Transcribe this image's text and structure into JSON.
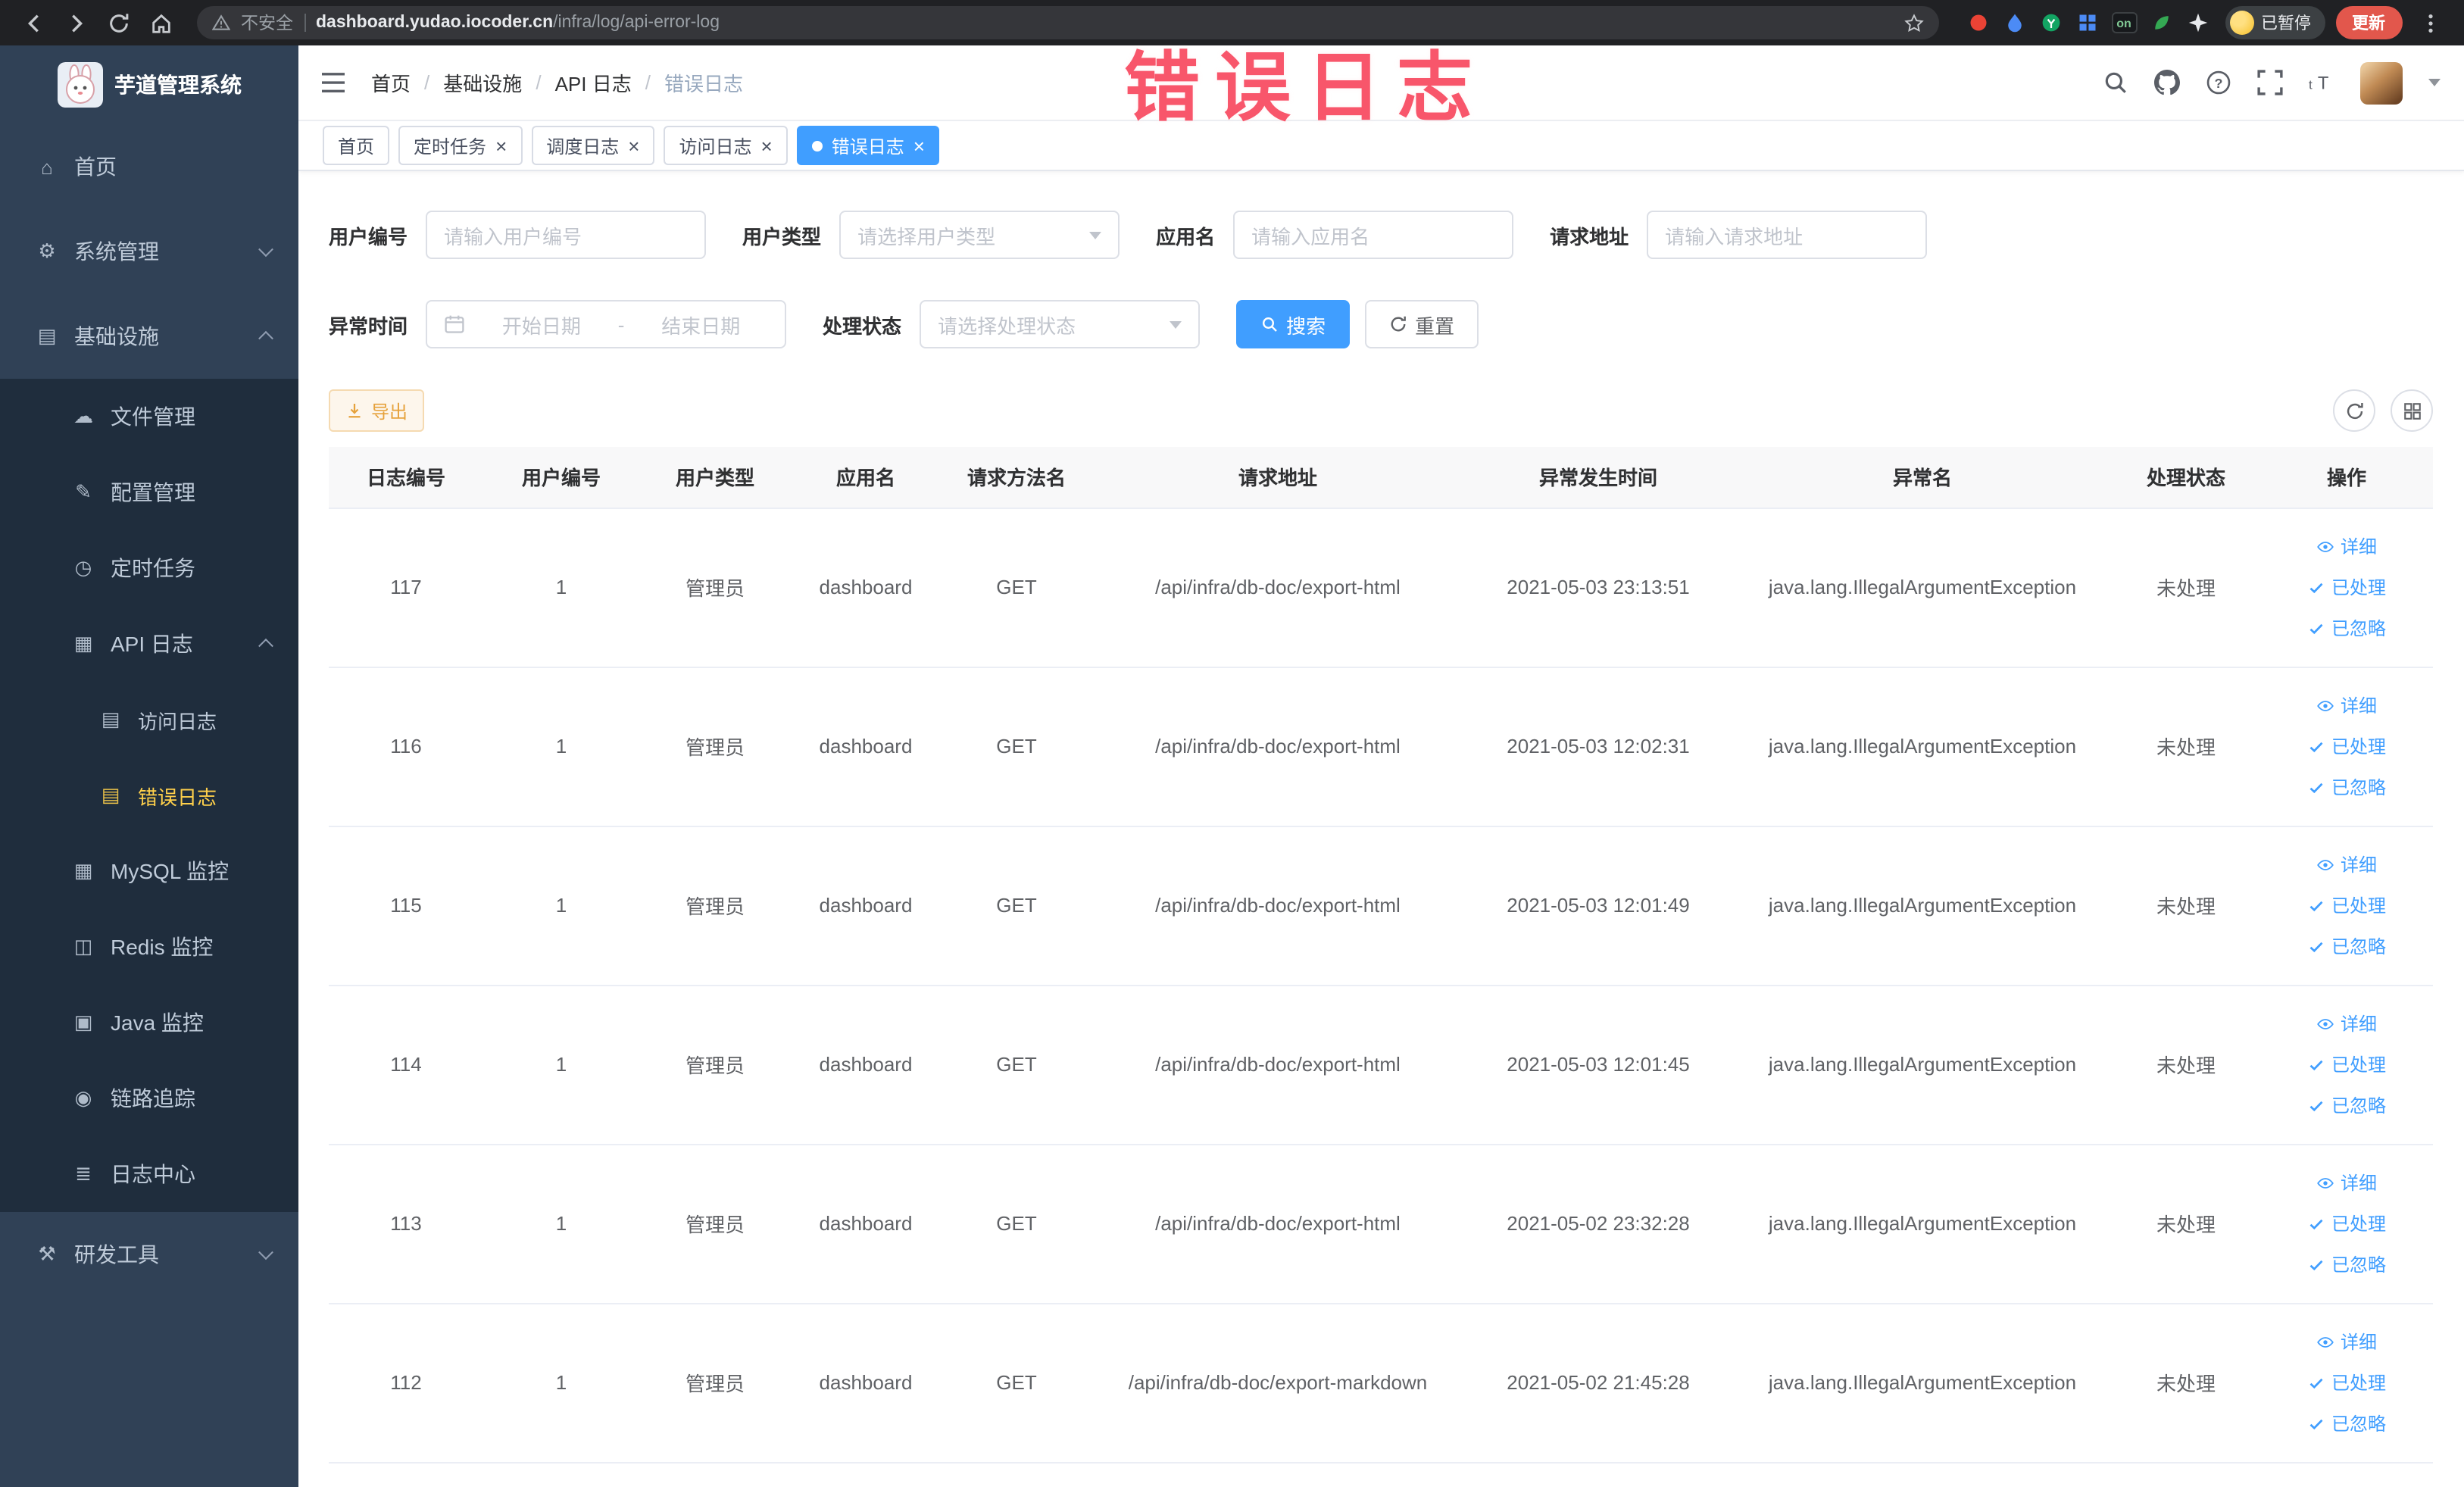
{
  "browser": {
    "security_label": "不安全",
    "url_domain": "dashboard.yudao.iocoder.cn",
    "url_path": "/infra/log/api-error-log",
    "ext_badge_on": "on",
    "paused_label": "已暂停",
    "update_label": "更新"
  },
  "annotation": {
    "text": "错误日志",
    "color": "#f8566b"
  },
  "sidebar": {
    "logo_title": "芋道管理系统",
    "items": [
      {
        "key": "home",
        "label": "首页",
        "level": 1,
        "icon": "home"
      },
      {
        "key": "system",
        "label": "系统管理",
        "level": 1,
        "icon": "gear",
        "arrow": "down"
      },
      {
        "key": "infra",
        "label": "基础设施",
        "level": 1,
        "icon": "infra",
        "arrow": "up"
      },
      {
        "key": "file-manage",
        "label": "文件管理",
        "level": 2,
        "icon": "file"
      },
      {
        "key": "config-manage",
        "label": "配置管理",
        "level": 2,
        "icon": "config"
      },
      {
        "key": "cron-job",
        "label": "定时任务",
        "level": 2,
        "icon": "timer"
      },
      {
        "key": "api-log",
        "label": "API 日志",
        "level": 2,
        "icon": "api-log",
        "arrow": "up"
      },
      {
        "key": "access-log",
        "label": "访问日志",
        "level": 3,
        "icon": "doc"
      },
      {
        "key": "error-log",
        "label": "错误日志",
        "level": 3,
        "icon": "doc",
        "active": true
      },
      {
        "key": "mysql-monitor",
        "label": "MySQL 监控",
        "level": 2,
        "icon": "mysql"
      },
      {
        "key": "redis-monitor",
        "label": "Redis 监控",
        "level": 2,
        "icon": "redis"
      },
      {
        "key": "java-monitor",
        "label": "Java 监控",
        "level": 2,
        "icon": "java"
      },
      {
        "key": "trace",
        "label": "链路追踪",
        "level": 2,
        "icon": "trace"
      },
      {
        "key": "log-center",
        "label": "日志中心",
        "level": 2,
        "icon": "log-center"
      },
      {
        "key": "devtools",
        "label": "研发工具",
        "level": 1,
        "icon": "tools",
        "arrow": "down"
      }
    ]
  },
  "header": {
    "breadcrumb": [
      "首页",
      "基础设施",
      "API 日志",
      "错误日志"
    ]
  },
  "tabs": [
    {
      "key": "home",
      "label": "首页"
    },
    {
      "key": "cron-job",
      "label": "定时任务",
      "closable": true
    },
    {
      "key": "schedule-log",
      "label": "调度日志",
      "closable": true
    },
    {
      "key": "access-log",
      "label": "访问日志",
      "closable": true
    },
    {
      "key": "error-log",
      "label": "错误日志",
      "closable": true,
      "active": true
    }
  ],
  "filters": {
    "user_id": {
      "label": "用户编号",
      "placeholder": "请输入用户编号"
    },
    "user_type": {
      "label": "用户类型",
      "placeholder": "请选择用户类型"
    },
    "app_name": {
      "label": "应用名",
      "placeholder": "请输入应用名"
    },
    "request_url": {
      "label": "请求地址",
      "placeholder": "请输入请求地址"
    },
    "exception_time": {
      "label": "异常时间",
      "start_placeholder": "开始日期",
      "separator": "-",
      "end_placeholder": "结束日期"
    },
    "process_status": {
      "label": "处理状态",
      "placeholder": "请选择处理状态"
    },
    "search_label": "搜索",
    "reset_label": "重置"
  },
  "toolbar": {
    "export_label": "导出"
  },
  "table": {
    "columns": [
      "日志编号",
      "用户编号",
      "用户类型",
      "应用名",
      "请求方法名",
      "请求地址",
      "异常发生时间",
      "异常名",
      "处理状态",
      "操作"
    ],
    "action_labels": [
      "详细",
      "已处理",
      "已忽略"
    ],
    "rows": [
      {
        "id": "117",
        "user_id": "1",
        "user_type": "管理员",
        "app": "dashboard",
        "method": "GET",
        "url": "/api/infra/db-doc/export-html",
        "time": "2021-05-03 23:13:51",
        "exception": "java.lang.IllegalArgumentException",
        "status": "未处理"
      },
      {
        "id": "116",
        "user_id": "1",
        "user_type": "管理员",
        "app": "dashboard",
        "method": "GET",
        "url": "/api/infra/db-doc/export-html",
        "time": "2021-05-03 12:02:31",
        "exception": "java.lang.IllegalArgumentException",
        "status": "未处理"
      },
      {
        "id": "115",
        "user_id": "1",
        "user_type": "管理员",
        "app": "dashboard",
        "method": "GET",
        "url": "/api/infra/db-doc/export-html",
        "time": "2021-05-03 12:01:49",
        "exception": "java.lang.IllegalArgumentException",
        "status": "未处理"
      },
      {
        "id": "114",
        "user_id": "1",
        "user_type": "管理员",
        "app": "dashboard",
        "method": "GET",
        "url": "/api/infra/db-doc/export-html",
        "time": "2021-05-03 12:01:45",
        "exception": "java.lang.IllegalArgumentException",
        "status": "未处理"
      },
      {
        "id": "113",
        "user_id": "1",
        "user_type": "管理员",
        "app": "dashboard",
        "method": "GET",
        "url": "/api/infra/db-doc/export-html",
        "time": "2021-05-02 23:32:28",
        "exception": "java.lang.IllegalArgumentException",
        "status": "未处理"
      },
      {
        "id": "112",
        "user_id": "1",
        "user_type": "管理员",
        "app": "dashboard",
        "method": "GET",
        "url": "/api/infra/db-doc/export-markdown",
        "time": "2021-05-02 21:45:28",
        "exception": "java.lang.IllegalArgumentException",
        "status": "未处理"
      }
    ]
  },
  "colors": {
    "primary": "#409eff",
    "sidebar_bg": "#304156",
    "submenu_bg": "#1f2d3d",
    "menu_text": "#bfcbd9",
    "menu_active_text": "#ffd04b",
    "annotation_text": "#f8566b",
    "export_bg": "#fdf6ec",
    "export_border": "#f5dab1",
    "export_text": "#e6a23c"
  }
}
